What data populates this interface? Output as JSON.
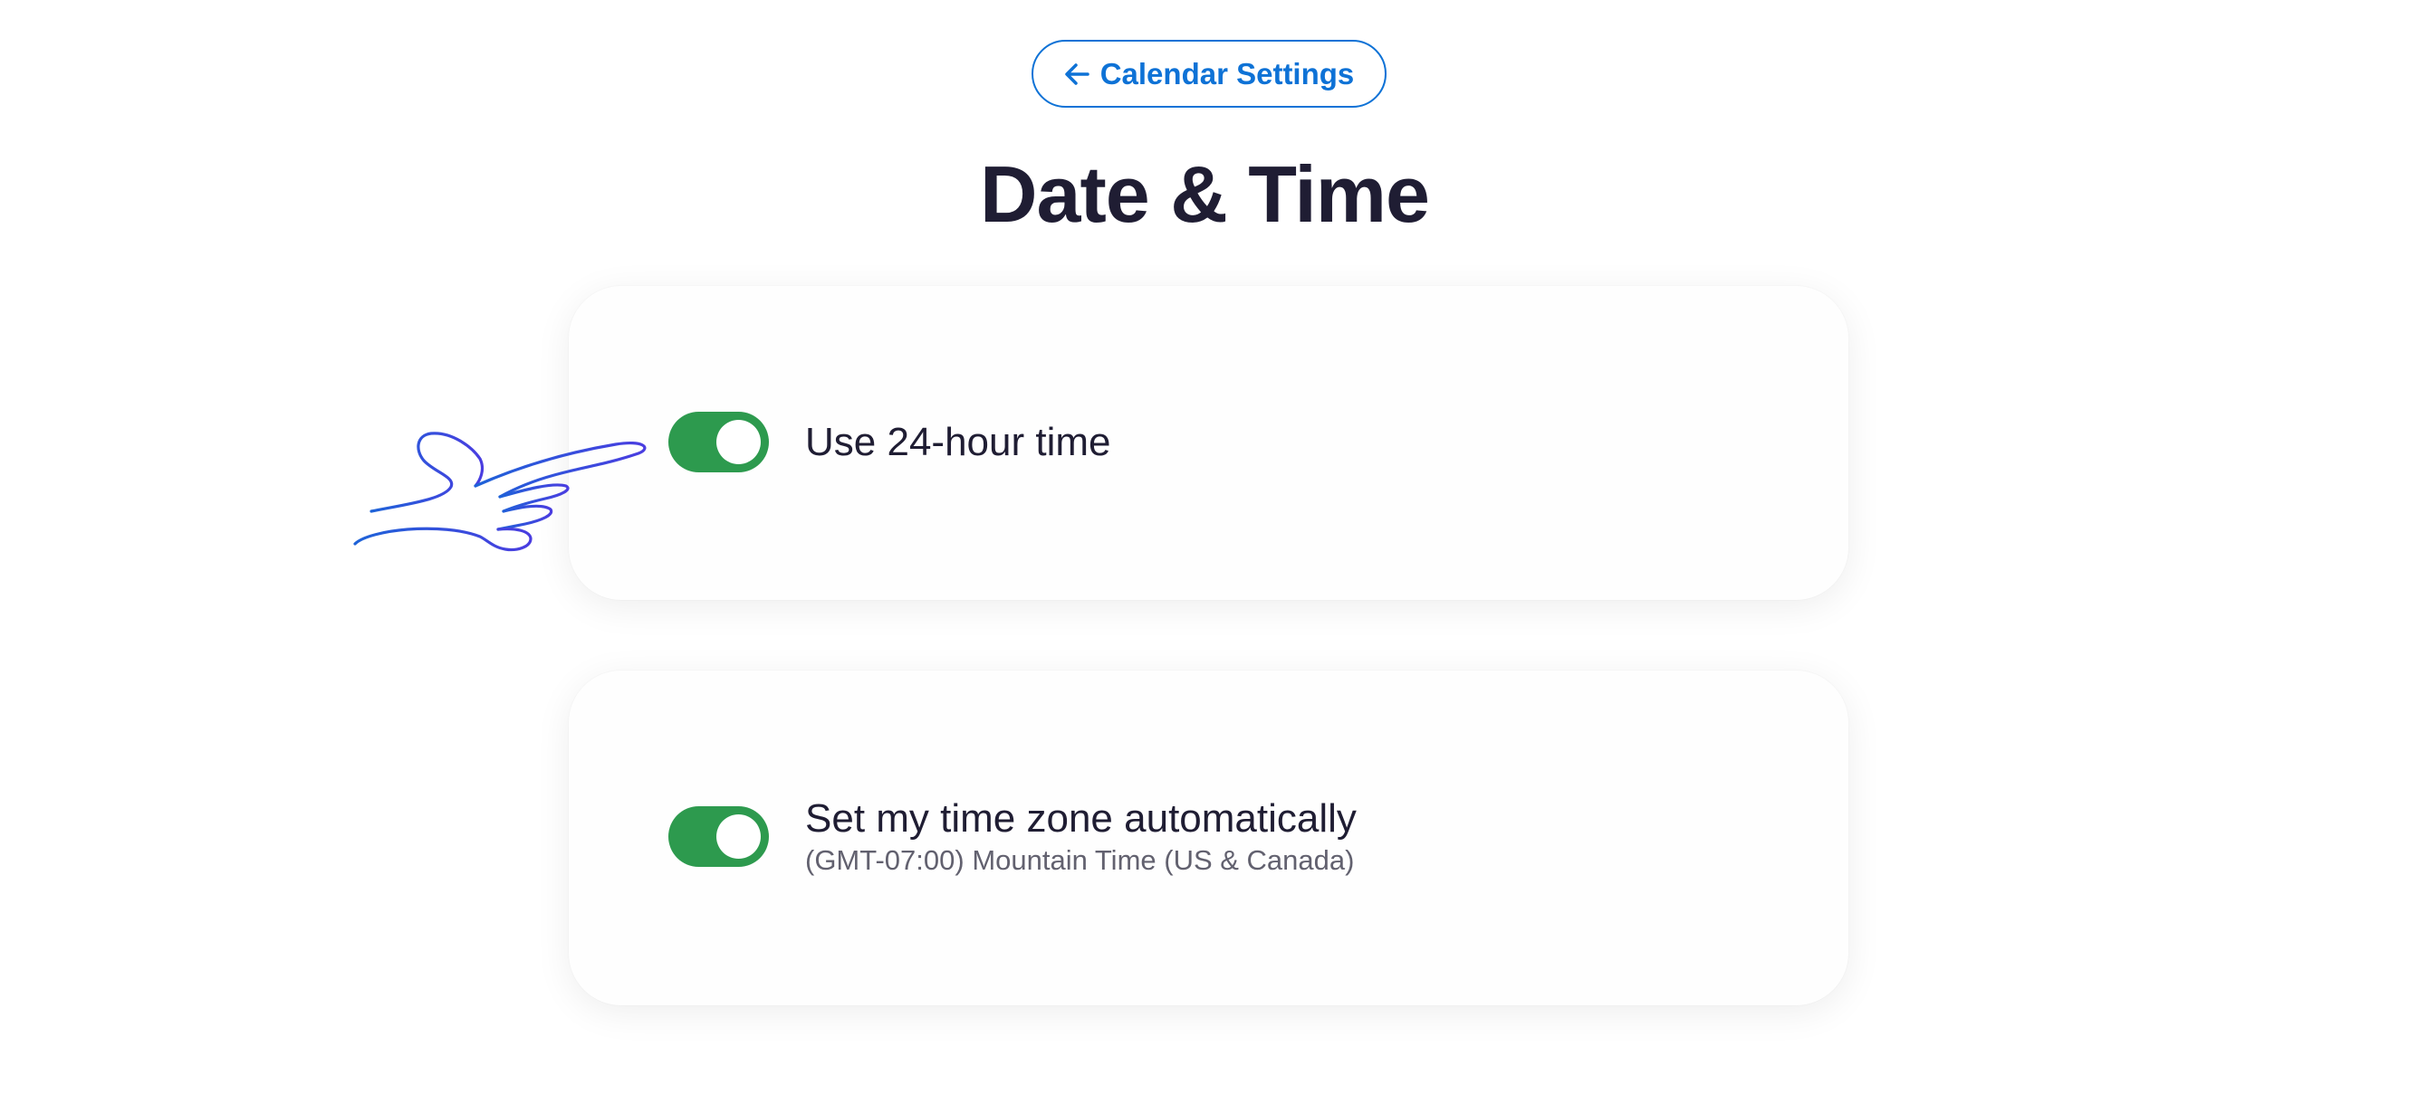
{
  "nav": {
    "back_label": "Calendar Settings",
    "back_icon": "arrow-left-icon"
  },
  "page": {
    "title": "Date & Time"
  },
  "settings": [
    {
      "label": "Use 24-hour time",
      "sublabel": "",
      "enabled": true
    },
    {
      "label": "Set my time zone automatically",
      "sublabel": "(GMT-07:00) Mountain Time (US & Canada)",
      "enabled": true
    }
  ],
  "annotation": {
    "icon": "pointing-hand-icon"
  },
  "colors": {
    "accent": "#0e72d6",
    "toggle_on": "#2d9a4e",
    "title": "#1f1d33",
    "sublabel": "#62616f",
    "annotation_stroke": "#3a4fe0"
  }
}
